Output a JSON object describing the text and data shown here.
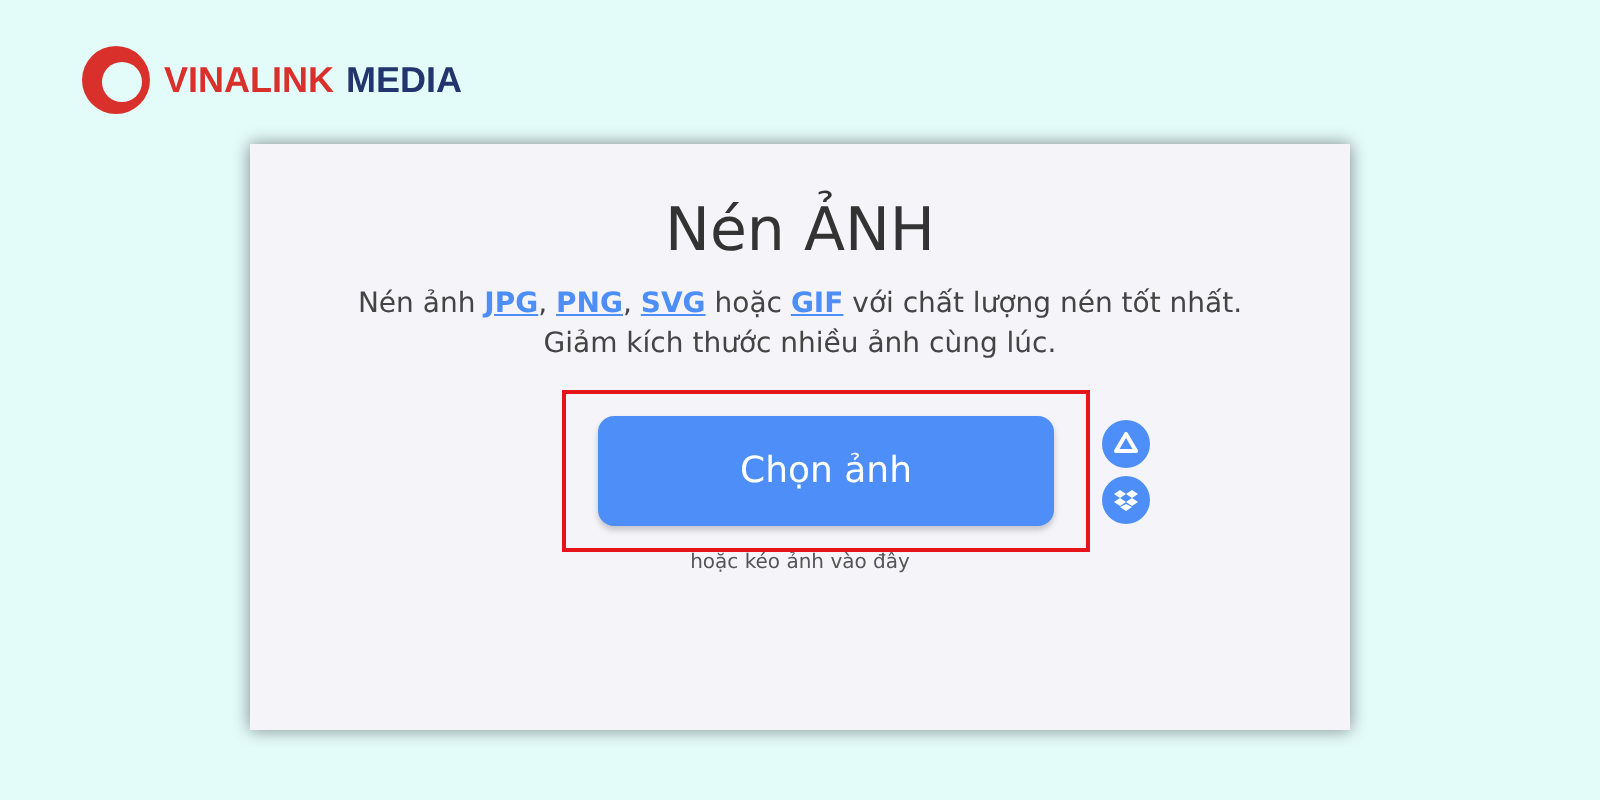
{
  "logo": {
    "brand": "VINALINK",
    "suffix": "MEDIA"
  },
  "card": {
    "title": "Nén ẢNH",
    "description": [
      {
        "kind": "text",
        "text": "Nén ảnh "
      },
      {
        "kind": "link",
        "text": "JPG"
      },
      {
        "kind": "text",
        "text": ", "
      },
      {
        "kind": "link",
        "text": "PNG"
      },
      {
        "kind": "text",
        "text": ", "
      },
      {
        "kind": "link",
        "text": "SVG"
      },
      {
        "kind": "text",
        "text": " hoặc "
      },
      {
        "kind": "link",
        "text": "GIF"
      },
      {
        "kind": "text",
        "text": " với chất lượng nén tốt nhất."
      }
    ],
    "subtitle": "Giảm kích thước nhiều ảnh cùng lúc.",
    "button": "Chọn ảnh",
    "highlighted": true,
    "hint": "hoặc kéo ảnh vào đây"
  }
}
